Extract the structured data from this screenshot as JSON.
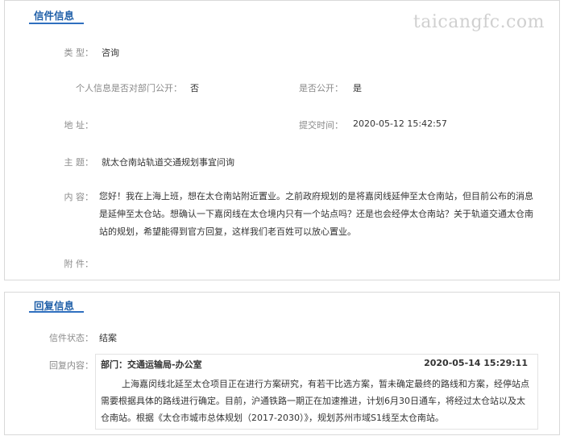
{
  "letter": {
    "section_title": "信件信息",
    "watermark": "taicangfc.com",
    "type_label": "类 型：",
    "type_value": "咨询",
    "privacy_label": "个人信息是否对部门公开：",
    "privacy_value": "否",
    "public_label": "是否公开：",
    "public_value": "是",
    "address_label": "地 址：",
    "address_value": "",
    "submit_label": "提交时间：",
    "submit_value": "2020-05-12 15:42:57",
    "subject_label": "主 题：",
    "subject_value": "就太仓南站轨道交通规划事宜问询",
    "content_label": "内 容：",
    "content_value": "您好！我在上海上班，想在太仓南站附近置业。之前政府规划的是将嘉闵线延伸至太仓南站，但目前公布的消息是延伸至太仓站。想确认一下嘉闵线在太仓境内只有一个站点吗？还是也会经停太仓南站？关于轨道交通太仓南站的规划，希望能得到官方回复，这样我们老百姓可以放心置业。",
    "attachment_label": "附 件："
  },
  "reply": {
    "section_title": "回复信息",
    "status_label": "信件状态：",
    "status_value": "结案",
    "content_label": "回复内容：",
    "department": "部门：交通运输局-办公室",
    "time": "2020-05-14 15:29:11",
    "text": "上海嘉闵线北延至太仓项目正在进行方案研究，有若干比选方案，暂未确定最终的路线和方案，经停站点需要根据具体的路线进行确定。目前，沪通铁路一期正在加速推进，计划6月30日通车，将经过太仓站以及太仓南站。根据《太仓市城市总体规划（2017-2030）》，规划苏州市域S1线至太仓南站。"
  }
}
